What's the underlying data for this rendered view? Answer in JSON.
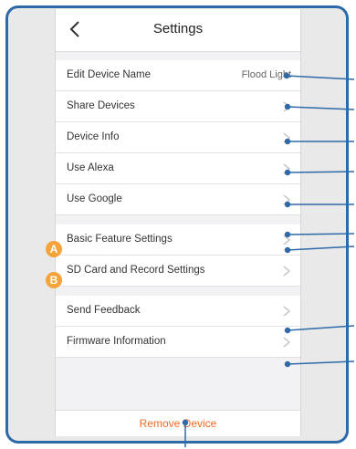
{
  "nav": {
    "title": "Settings",
    "back_icon": "chevron-left-icon"
  },
  "rows": [
    {
      "label": "Edit Device Name",
      "value": "Flood Light"
    },
    {
      "label": "Share Devices"
    },
    {
      "label": "Device Info"
    },
    {
      "label": "Use Alexa"
    },
    {
      "label": "Use Google"
    },
    {
      "label": "Basic Feature Settings"
    },
    {
      "label": "SD Card and Record Settings"
    },
    {
      "label": "Send Feedback"
    },
    {
      "label": "Firmware Information"
    }
  ],
  "badges": [
    "A",
    "B"
  ],
  "remove": {
    "label": "Remove Device"
  },
  "colors": {
    "frame": "#2e6aa8",
    "accent": "#f26a21",
    "badge": "#f5a33a"
  }
}
